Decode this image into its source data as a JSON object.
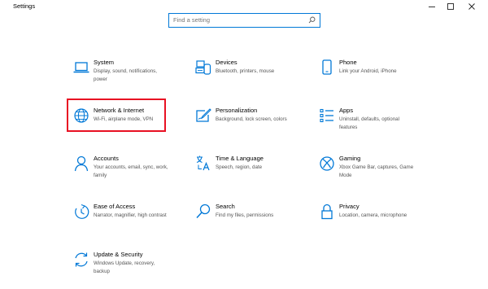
{
  "window": {
    "title": "Settings"
  },
  "search": {
    "placeholder": "Find a setting"
  },
  "accent": "#0078d7",
  "highlight_color": "#e81123",
  "categories": [
    {
      "name": "System",
      "desc": "Display, sound, notifications, power",
      "icon": "laptop-icon"
    },
    {
      "name": "Devices",
      "desc": "Bluetooth, printers, mouse",
      "icon": "keyboard-icon"
    },
    {
      "name": "Phone",
      "desc": "Link your Android, iPhone",
      "icon": "phone-icon"
    },
    {
      "name": "Network & Internet",
      "desc": "Wi-Fi, airplane mode, VPN",
      "icon": "globe-icon",
      "highlighted": true
    },
    {
      "name": "Personalization",
      "desc": "Background, lock screen, colors",
      "icon": "paint-icon"
    },
    {
      "name": "Apps",
      "desc": "Uninstall, defaults, optional features",
      "icon": "apps-list-icon"
    },
    {
      "name": "Accounts",
      "desc": "Your accounts, email, sync, work, family",
      "icon": "person-icon"
    },
    {
      "name": "Time & Language",
      "desc": "Speech, region, date",
      "icon": "time-language-icon"
    },
    {
      "name": "Gaming",
      "desc": "Xbox Game Bar, captures, Game Mode",
      "icon": "xbox-icon"
    },
    {
      "name": "Ease of Access",
      "desc": "Narrator, magnifier, high contrast",
      "icon": "ease-of-access-icon"
    },
    {
      "name": "Search",
      "desc": "Find my files, permissions",
      "icon": "search-icon"
    },
    {
      "name": "Privacy",
      "desc": "Location, camera, microphone",
      "icon": "lock-icon"
    },
    {
      "name": "Update & Security",
      "desc": "Windows Update, recovery, backup",
      "icon": "sync-icon"
    }
  ]
}
